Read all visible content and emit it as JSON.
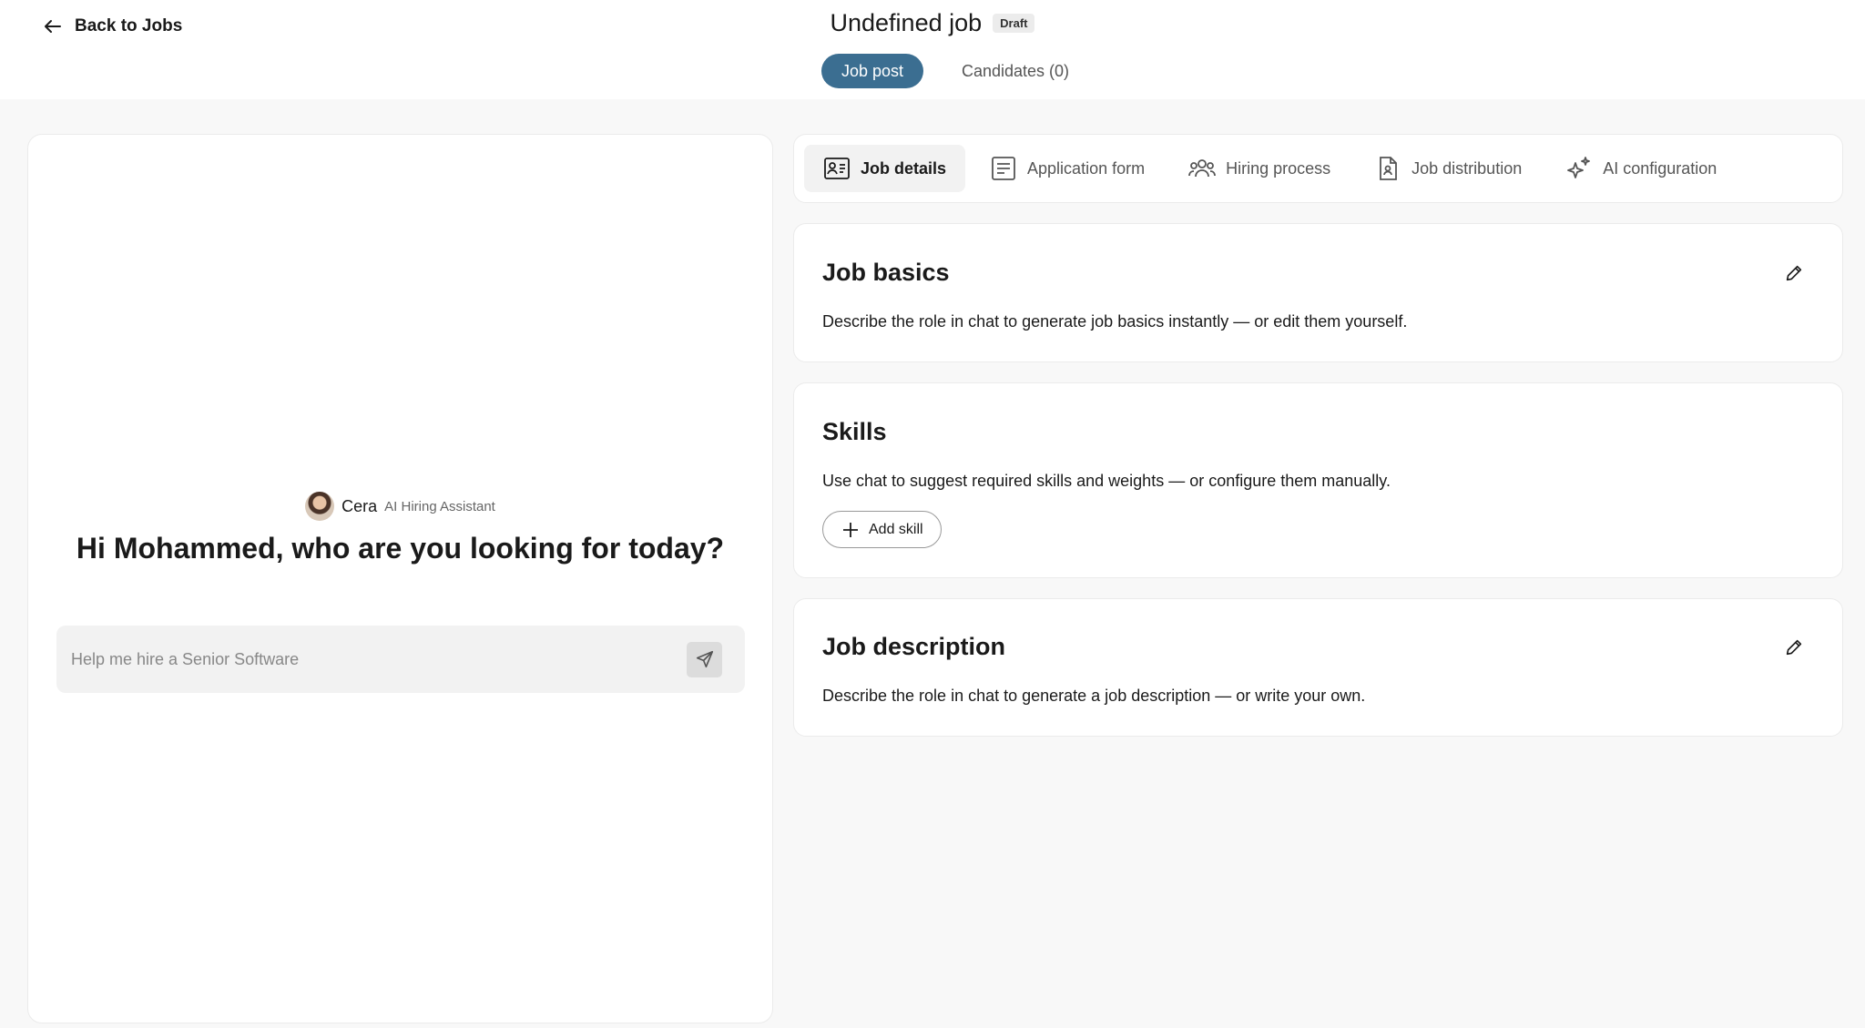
{
  "header": {
    "back_label": "Back to Jobs",
    "job_title": "Undefined job",
    "status_badge": "Draft",
    "tabs": [
      {
        "label": "Job post",
        "active": true
      },
      {
        "label": "Candidates (0)",
        "active": false
      }
    ]
  },
  "chat": {
    "assistant_name": "Cera",
    "assistant_role": "AI Hiring Assistant",
    "greeting": "Hi Mohammed, who are you looking for today?",
    "input_placeholder": "Help me hire a Senior Software"
  },
  "section_tabs": [
    {
      "label": "Job details",
      "icon": "id-card-icon",
      "active": true
    },
    {
      "label": "Application form",
      "icon": "form-icon",
      "active": false
    },
    {
      "label": "Hiring process",
      "icon": "people-icon",
      "active": false
    },
    {
      "label": "Job distribution",
      "icon": "document-person-icon",
      "active": false
    },
    {
      "label": "AI configuration",
      "icon": "sparkle-icon",
      "active": false
    }
  ],
  "cards": {
    "job_basics": {
      "title": "Job basics",
      "description": "Describe the role in chat to generate job basics instantly — or edit them yourself."
    },
    "skills": {
      "title": "Skills",
      "description": "Use chat to suggest required skills and weights — or configure them manually.",
      "add_label": "Add skill"
    },
    "job_description": {
      "title": "Job description",
      "description": "Describe the role in chat to generate a job description — or write your own."
    }
  },
  "colors": {
    "accent": "#3b6e91",
    "background": "#f8f8f8",
    "card": "#ffffff"
  }
}
